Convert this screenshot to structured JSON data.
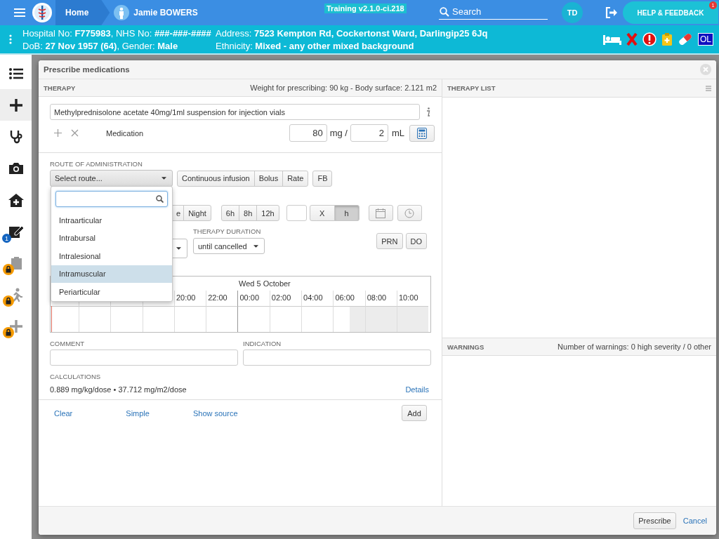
{
  "top_bar": {
    "home": "Home",
    "patient": "Jamie BOWERS",
    "environment": "Training v2.1.0-ci.218",
    "search": {
      "placeholder": "Search"
    },
    "user_initials": "TD",
    "help_button": "HELP & FEEDBACK",
    "help_badge": "1"
  },
  "patient_banner": {
    "lines": [
      [
        "Hospital No: **F775983**, NHS No: **###-###-####**",
        "Address: **7523 Kempton Rd, Cockertonst Ward, Darlingip25 6Jq**"
      ],
      [
        "DoB: **27 Nov 1957 (64)**, Gender: **Male**",
        "Ethnicity: **Mixed - any other mixed background**"
      ]
    ],
    "flags": [
      {
        "kind": "bed"
      },
      {
        "kind": "cross"
      },
      {
        "kind": "alert"
      },
      {
        "kind": "clipboard"
      },
      {
        "kind": "pill"
      },
      {
        "kind": "text",
        "label": "OL"
      }
    ]
  },
  "sidebar": {
    "items": [
      {
        "kind": "list",
        "selected": false,
        "locked": false
      },
      {
        "kind": "plus",
        "selected": true,
        "locked": false
      },
      {
        "kind": "stethoscope",
        "selected": false,
        "locked": false
      },
      {
        "kind": "camera",
        "selected": false,
        "locked": false
      },
      {
        "kind": "home",
        "selected": false,
        "locked": false
      },
      {
        "kind": "notes",
        "selected": false,
        "locked": false,
        "badge": "1"
      },
      {
        "kind": "clipboard",
        "selected": false,
        "locked": true
      },
      {
        "kind": "person",
        "selected": false,
        "locked": true
      },
      {
        "kind": "plus",
        "selected": false,
        "locked": true
      }
    ]
  },
  "modal": {
    "title": "Prescribe medications",
    "therapy": {
      "heading": "THERAPY",
      "weight_info": "Weight for prescribing: 90 kg - Body surface: 2.121 m2",
      "medication": "Methylprednisolone acetate 40mg/1ml suspension for injection vials",
      "medication_label": "Medication",
      "dose": {
        "value": "80",
        "unit": "mg /",
        "volume": "2",
        "volume_unit": "mL"
      },
      "route": {
        "label": "ROUTE OF ADMINISTRATION",
        "select": "Select route...",
        "buttons": [
          "Continuous infusion",
          "Bolus",
          "Rate"
        ],
        "extra_button": "FB",
        "dropdown": {
          "options": [
            {
              "label": "Intraarticular",
              "selected": false
            },
            {
              "label": "Intrabursal",
              "selected": false
            },
            {
              "label": "Intralesional",
              "selected": false
            },
            {
              "label": "Intramuscular",
              "selected": true
            },
            {
              "label": "Periarticular",
              "selected": false
            }
          ]
        }
      },
      "frequency": {
        "buttons": [
          "e",
          "Night"
        ],
        "intervals": [
          "6h",
          "8h",
          "12h"
        ],
        "units": [
          {
            "label": "X",
            "selected": false
          },
          {
            "label": "h",
            "selected": true
          }
        ]
      },
      "duration": {
        "label": "THERAPY DURATION",
        "select": "until cancelled",
        "buttons": [
          "PRN",
          "DO"
        ]
      },
      "timeline": {
        "day": "Wed 5 October",
        "times": [
          "20:00",
          "22:00",
          "00:00",
          "02:00",
          "04:00",
          "06:00",
          "08:00",
          "10:00"
        ]
      },
      "comment": {
        "label": "COMMENT"
      },
      "indication": {
        "label": "INDICATION"
      },
      "calculations": {
        "label": "CALCULATIONS",
        "text": "0.889 mg/kg/dose • 37.712 mg/m2/dose",
        "details": "Details"
      },
      "actions": {
        "links": [
          "Clear",
          "Simple",
          "Show source"
        ],
        "add": "Add"
      }
    },
    "therapy_list": {
      "heading": "THERAPY LIST"
    },
    "warnings": {
      "heading": "WARNINGS",
      "summary": "Number of warnings: 0 high severity / 0 other"
    },
    "footer": {
      "prescribe": "Prescribe",
      "cancel": "Cancel"
    }
  }
}
